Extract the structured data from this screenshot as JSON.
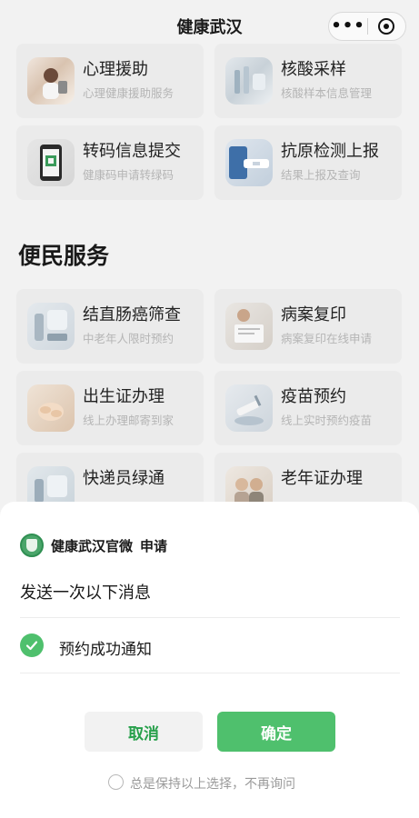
{
  "header": {
    "title": "健康武汉",
    "more_icon": "ellipsis-icon",
    "close_icon": "target-icon"
  },
  "section_title": "便民服务",
  "cards": [
    {
      "title": "心理援助",
      "subtitle": "心理健康援助服务",
      "icon": "counseling-photo"
    },
    {
      "title": "核酸采样",
      "subtitle": "核酸样本信息管理",
      "icon": "lab-photo"
    },
    {
      "title": "转码信息提交",
      "subtitle": "健康码申请转绿码",
      "icon": "phone-qr-photo"
    },
    {
      "title": "抗原检测上报",
      "subtitle": "结果上报及查询",
      "icon": "antigen-test-photo"
    },
    {
      "title": "结直肠癌筛查",
      "subtitle": "中老年人限时预约",
      "icon": "screening-photo"
    },
    {
      "title": "病案复印",
      "subtitle": "病案复印在线申请",
      "icon": "records-photo"
    },
    {
      "title": "出生证办理",
      "subtitle": "线上办理邮寄到家",
      "icon": "baby-photo"
    },
    {
      "title": "疫苗预约",
      "subtitle": "线上实时预约疫苗",
      "icon": "vaccine-photo"
    },
    {
      "title": "快递员绿通",
      "subtitle": "",
      "icon": "courier-photo"
    },
    {
      "title": "老年证办理",
      "subtitle": "",
      "icon": "elderly-photo"
    }
  ],
  "sheet": {
    "app_name": "健康武汉官微",
    "request": "申请",
    "heading": "发送一次以下消息",
    "item_label": "预约成功通知",
    "cancel": "取消",
    "confirm": "确定",
    "remember": "总是保持以上选择，不再询问",
    "accent": "#4fc06d"
  }
}
